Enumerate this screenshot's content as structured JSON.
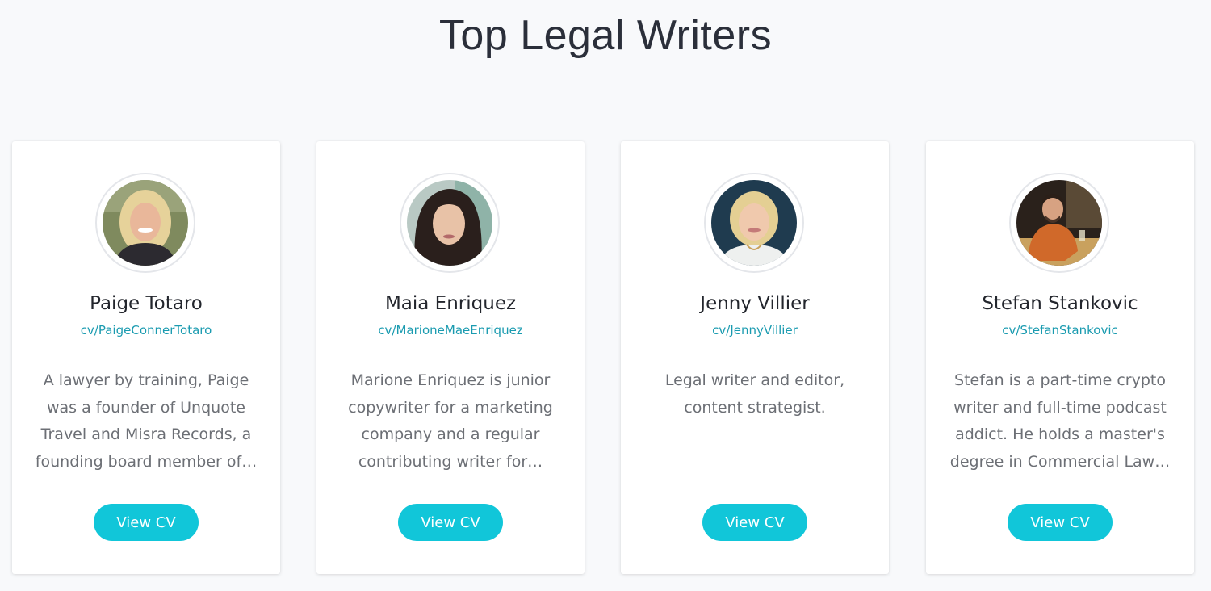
{
  "page": {
    "title": "Top Legal Writers"
  },
  "theme": {
    "accent": "#11c6d9",
    "link": "#1a9bb0",
    "background": "#f8f9fb"
  },
  "writers": [
    {
      "name": "Paige Totaro",
      "handle": "cv/PaigeConnerTotaro",
      "bio": "A lawyer by training, Paige was a founder of Unquote Travel and Misra Records, a founding board member of…",
      "button_label": "View CV",
      "avatar_icon": "avatar-photo-paige"
    },
    {
      "name": "Maia Enriquez",
      "handle": "cv/MarioneMaeEnriquez",
      "bio": "Marione Enriquez is junior copywriter for a marketing company and a regular contributing writer for…",
      "button_label": "View CV",
      "avatar_icon": "avatar-photo-maia"
    },
    {
      "name": "Jenny Villier",
      "handle": "cv/JennyVillier",
      "bio": "Legal writer and editor, content strategist.",
      "button_label": "View CV",
      "avatar_icon": "avatar-photo-jenny"
    },
    {
      "name": "Stefan Stankovic",
      "handle": "cv/StefanStankovic",
      "bio": "Stefan is a part-time crypto writer and full-time podcast addict. He holds a master's degree in Commercial Law…",
      "button_label": "View CV",
      "avatar_icon": "avatar-photo-stefan"
    }
  ]
}
